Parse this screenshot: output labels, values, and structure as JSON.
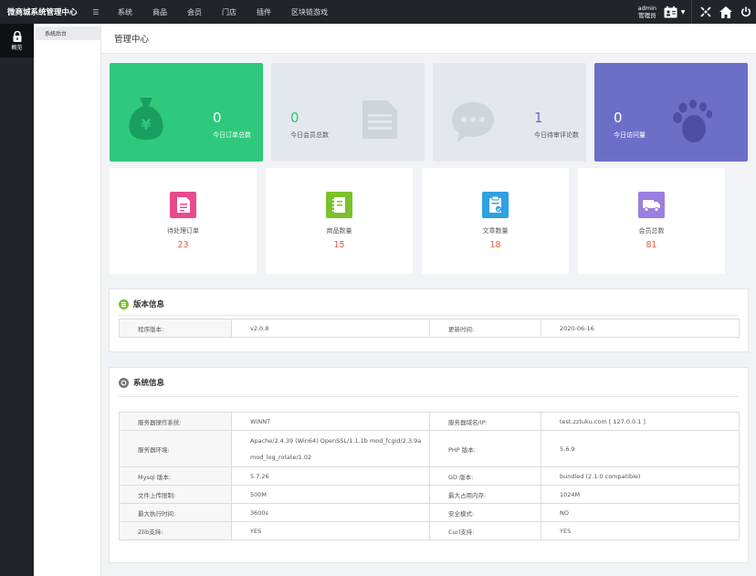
{
  "app": {
    "title": "微商城系统管理中心",
    "nav": [
      "系统",
      "商品",
      "会员",
      "门店",
      "插件",
      "区块链游戏"
    ],
    "user": {
      "name": "admin",
      "role": "管理员"
    }
  },
  "sidebar": {
    "items": [
      {
        "label": "概览",
        "icon": "lock-icon"
      }
    ],
    "sub_items": [
      {
        "label": "系统后台"
      }
    ]
  },
  "page": {
    "title": "管理中心"
  },
  "stats": [
    {
      "value": "0",
      "label": "今日订单总数",
      "color": "#2ec97d",
      "icon": "money-bag-icon"
    },
    {
      "value": "0",
      "label": "今日会员总数",
      "color": "#e4e8ec",
      "icon": "document-icon"
    },
    {
      "value": "1",
      "label": "今日待审评论数",
      "color": "#e4e8ec",
      "icon": "chat-bubble-icon"
    },
    {
      "value": "0",
      "label": "今日访问量",
      "color": "#6c6fc8",
      "icon": "footprint-icon"
    }
  ],
  "counts": [
    {
      "label": "待处理订单",
      "value": "23",
      "color": "#e94a8c",
      "icon": "order-icon"
    },
    {
      "label": "商品数量",
      "value": "15",
      "color": "#7bc12b",
      "icon": "notebook-icon"
    },
    {
      "label": "文章数量",
      "value": "18",
      "color": "#2ea1e0",
      "icon": "clipboard-check-icon"
    },
    {
      "label": "会员总数",
      "value": "81",
      "color": "#9a7ee0",
      "icon": "truck-icon"
    }
  ],
  "version_panel": {
    "title": "版本信息",
    "rows": [
      {
        "k1": "程序版本:",
        "v1": "v2.0.8",
        "k2": "更新时间:",
        "v2": "2020-06-16"
      }
    ]
  },
  "system_panel": {
    "title": "系统信息",
    "rows": [
      {
        "k1": "服务器操作系统:",
        "v1": "WINNT",
        "k2": "服务器域名/IP:",
        "v2": "test.zztuku.com [ 127.0.0.1 ]"
      },
      {
        "k1": "服务器环境:",
        "v1a": "Apache/2.4.39 (Win64) OpenSSL/1.1.1b mod_fcgid/2.3.9a",
        "v1b": "mod_log_rotate/1.02",
        "k2": "PHP 版本:",
        "v2": "5.6.9"
      },
      {
        "k1": "Mysql 版本:",
        "v1": "5.7.26",
        "k2": "GD 版本:",
        "v2": "bundled (2.1.0 compatible)"
      },
      {
        "k1": "文件上传限制:",
        "v1": "500M",
        "k2": "最大占用内存:",
        "v2": "1024M"
      },
      {
        "k1": "最大执行时间:",
        "v1": "3600s",
        "k2": "安全模式:",
        "v2": "NO"
      },
      {
        "k1": "Zlib支持:",
        "v1": "YES",
        "k2": "Curl支持:",
        "v2": "YES"
      }
    ]
  }
}
